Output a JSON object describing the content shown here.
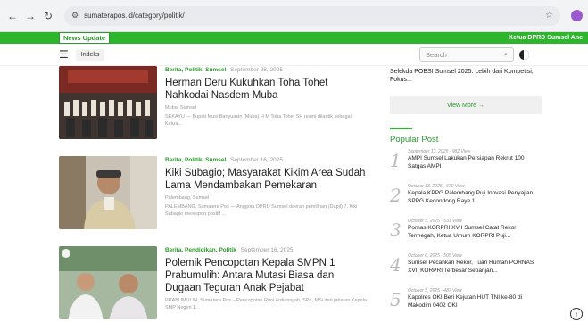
{
  "browser": {
    "url": "sumaterapos.id/category/politik/"
  },
  "ticker": {
    "tag": "News Update",
    "text": "Ketua DPRD Sumsel Anc"
  },
  "navbar": {
    "indeks": "Indeks",
    "search_placeholder": "Search"
  },
  "articles": [
    {
      "cats": "Berita, Politik, Sumsel",
      "date": "September 28, 2025",
      "title": "Herman Deru Kukuhkan Toha Tohet Nahkodai Nasdem Muba",
      "loc": "Muba, Sumsel",
      "excerpt": "SEKAYU — Bupati Musi Banyuasin (Muba) H M Toha Tohet SH resmi dilantik sebagai Ketua..."
    },
    {
      "cats": "Berita, Politik, Sumsel",
      "date": "September 16, 2025",
      "title": "Kiki Subagio; Masyarakat Kikim Area Sudah Lama Mendambakan Pemekaran",
      "loc": "Palembang, Sumsel",
      "excerpt": "PALEMBANG, Sumatera Pos — Anggota DPRD Sumsel daerah pemilihan (Dapil) 7, Kiki Subagio merespon positif ..."
    },
    {
      "cats": "Berita, Pendidikan, Politik",
      "date": "September 16, 2025",
      "title": "Polemik Pencopotan Kepala SMPN 1 Prabumulih: Antara Mutasi Biasa dan Dugaan Teguran Anak Pejabat",
      "loc": "",
      "excerpt": "PRABUMULIH, Sumatera Pos – Pencopotan Roni Ardiansyah, SPd, MSi dari jabatan Kepala SMP Negeri 1..."
    }
  ],
  "sidebar": {
    "top_text": "Selekda POBSI Sumsel 2025: Lebih dari Kompetisi, Fokus...",
    "view_more": "View More →",
    "popular_title": "Popular Post",
    "popular": [
      {
        "num": "1",
        "meta": "September 13, 2025 · 982 View",
        "text": "AMPI Sumsel Lakukan Persiapan Rekrut 100 Satgas AMPI"
      },
      {
        "num": "2",
        "meta": "October 13, 2025 · 670 View",
        "text": "Kepala KPPG Palembang Puji Inovasi Penyajian SPPG Kedondong Raye 1"
      },
      {
        "num": "3",
        "meta": "October 5, 2025 · 531 View",
        "text": "Pornas KORPRI XVII Sumsel Catat Rekor Termegah, Ketua Umum KORPRI Puji..."
      },
      {
        "num": "4",
        "meta": "October 6, 2025 · 505 View",
        "text": "Sumsel Pecahkan Rekor, Tuan Rumah PORNAS XVII KORPRI Terbesar Sepanjan..."
      },
      {
        "num": "5",
        "meta": "October 5, 2025 · 487 View",
        "text": "Kapolres OKI Beri Kejutan HUT TNI ke-80 di Makodim 0402 OKI"
      }
    ]
  },
  "colors": {
    "accent": "#2db52d",
    "accent_dark": "#2b9a2b"
  },
  "icons": [
    "back-icon",
    "forward-icon",
    "reload-icon",
    "tune-icon",
    "star-icon",
    "hamburger-icon",
    "search-icon",
    "dark-mode-icon",
    "arrow-up-icon"
  ]
}
